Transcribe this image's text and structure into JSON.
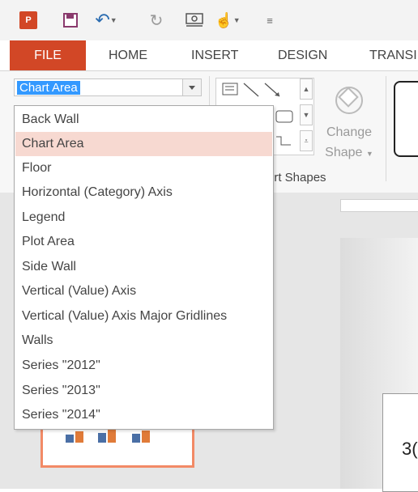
{
  "app": {
    "logo_label": "P"
  },
  "ribbon_tabs": [
    "FILE",
    "HOME",
    "INSERT",
    "DESIGN",
    "TRANSI"
  ],
  "chart_elements": {
    "selected": "Chart Area",
    "options": [
      "Back Wall",
      "Chart Area",
      "Floor",
      "Horizontal (Category) Axis",
      "Legend",
      "Plot Area",
      "Side Wall",
      "Vertical (Value) Axis",
      "Vertical (Value) Axis Major Gridlines",
      "Walls",
      "Series \"2012\"",
      "Series \"2013\"",
      "Series \"2014\""
    ]
  },
  "ribbon": {
    "change_shape_line1": "Change",
    "change_shape_line2": "Shape",
    "group_insert_shapes": "ert Shapes"
  },
  "slide": {
    "number_fragment": "3("
  },
  "colors": {
    "accent": "#d24726",
    "selection_highlight": "#3399ff",
    "hover": "#f7d9d1"
  }
}
